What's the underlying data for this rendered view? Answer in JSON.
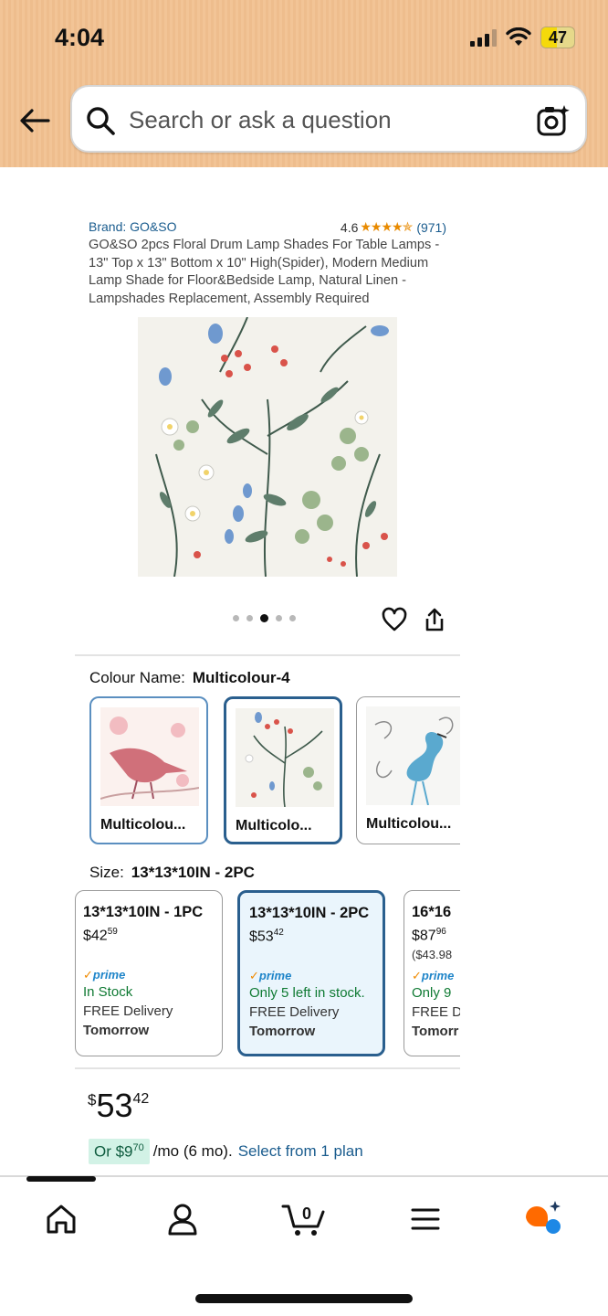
{
  "status_bar": {
    "time": "4:04",
    "battery": "47"
  },
  "search": {
    "placeholder": "Search or ask a question"
  },
  "product": {
    "brand": "Brand: GO&SO",
    "rating": "4.6",
    "stars": "★★★★✯",
    "review_count": "(971)",
    "title": "GO&SO 2pcs Floral Drum Lamp Shades For Table Lamps - 13\" Top x 13\" Bottom x 10\" High(Spider), Modern Medium Lamp Shade for Floor&Bedside Lamp, Natural Linen - Lampshades Replacement, Assembly Required",
    "image_icon": "floral-lampshade-image",
    "image_count": 5,
    "active_image_index": 2
  },
  "colour": {
    "label": "Colour Name:",
    "selected": "Multicolour-4",
    "options": [
      {
        "label": "Multicolou...",
        "icon": "pink-bird-floral"
      },
      {
        "label": "Multicolo...",
        "icon": "wildflower-floral"
      },
      {
        "label": "Multicolou...",
        "icon": "blue-flamingo-floral"
      }
    ]
  },
  "size": {
    "label": "Size:",
    "selected": "13*13*10IN - 2PC",
    "options": [
      {
        "size": "13*13*10IN - 1PC",
        "price_whole": "$42",
        "price_frac": "59",
        "unit_price": "",
        "prime": "prime",
        "stock": "In Stock",
        "delivery": "FREE Delivery",
        "when": "Tomorrow"
      },
      {
        "size": "13*13*10IN - 2PC",
        "price_whole": "$53",
        "price_frac": "42",
        "unit_price": "",
        "prime": "prime",
        "stock": "Only 5 left in stock.",
        "delivery": "FREE Delivery",
        "when": "Tomorrow"
      },
      {
        "size": "16*16",
        "price_whole": "$87",
        "price_frac": "96",
        "unit_price": "($43.98",
        "prime": "prime",
        "stock": "Only 9",
        "delivery": "FREE D",
        "when": "Tomorr"
      }
    ]
  },
  "price": {
    "symbol": "$",
    "whole": "53",
    "fraction": "42"
  },
  "instalment": {
    "prefix": "Or $9",
    "cents": "70",
    "suffix": "/mo (6 mo).",
    "link": "Select from 1 plan"
  },
  "nav": {
    "items": [
      "home",
      "account",
      "cart",
      "menu",
      "rufus"
    ],
    "cart_count": "0"
  },
  "colors": {
    "header": "#f2c496",
    "link": "#1a5c8e",
    "selected_border": "#2a5f8e",
    "in_stock": "#0f7a33",
    "star": "#e88a00"
  }
}
